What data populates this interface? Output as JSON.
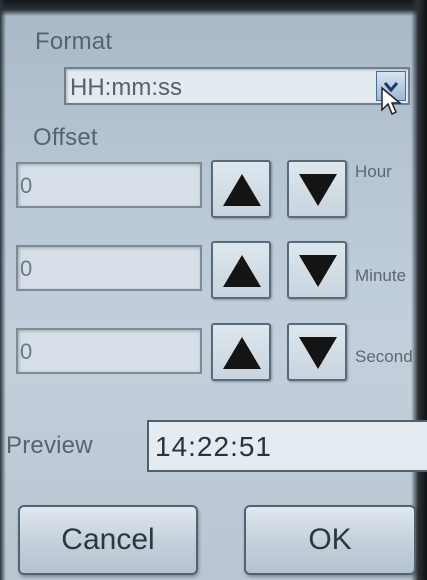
{
  "format": {
    "label": "Format",
    "selected": "HH:mm:ss"
  },
  "offset": {
    "label": "Offset",
    "rows": [
      {
        "value": "0",
        "unit": "Hour"
      },
      {
        "value": "0",
        "unit": "Minute"
      },
      {
        "value": "0",
        "unit": "Second"
      }
    ]
  },
  "preview": {
    "label": "Preview",
    "value": "14:22:51"
  },
  "actions": {
    "cancel": "Cancel",
    "ok": "OK"
  },
  "icons": {
    "dropdown": "chevron-down-icon",
    "up": "up-triangle-icon",
    "down": "down-triangle-icon",
    "cursor": "mouse-pointer-icon"
  },
  "colors": {
    "background": "#b8c6d4",
    "button": "#c8d4de",
    "arrow": "#1a1a1a"
  }
}
